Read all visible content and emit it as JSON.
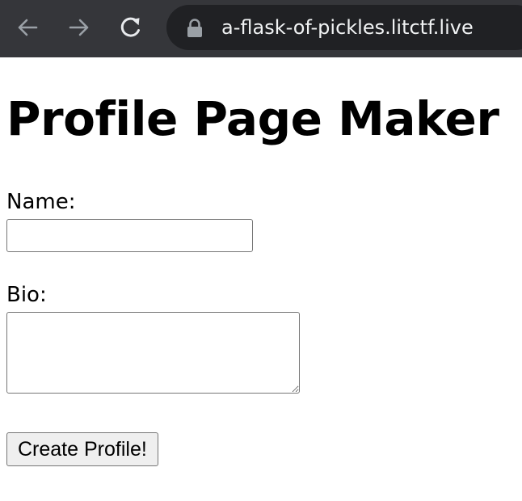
{
  "browser": {
    "url": "a-flask-of-pickles.litctf.live",
    "icons": {
      "back": "arrow-left-icon",
      "forward": "arrow-right-icon",
      "reload": "reload-icon",
      "secure": "lock-icon"
    }
  },
  "page": {
    "title": "Profile Page Maker",
    "form": {
      "name_label": "Name:",
      "name_value": "",
      "bio_label": "Bio:",
      "bio_value": "",
      "submit_label": "Create Profile!"
    }
  },
  "colors": {
    "toolbar_bg": "#35363a",
    "address_bg": "#202124",
    "url_text": "#f1f3f4",
    "nav_icon": "#9aa0a6",
    "reload_icon": "#e8eaed"
  }
}
